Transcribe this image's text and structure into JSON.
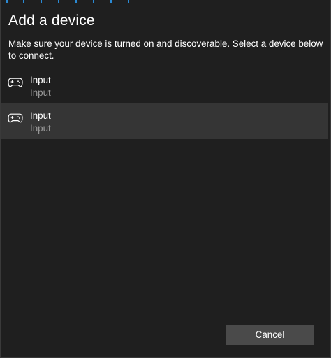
{
  "dialog": {
    "title": "Add a device",
    "instructions": "Make sure your device is turned on and discoverable. Select a device below to connect."
  },
  "devices": [
    {
      "name": "Input",
      "type": "Input",
      "icon": "gamepad-icon",
      "selected": false
    },
    {
      "name": "Input",
      "type": "Input",
      "icon": "gamepad-icon",
      "selected": true
    }
  ],
  "footer": {
    "cancel_label": "Cancel"
  },
  "colors": {
    "background": "#1f1f1f",
    "selected_row": "#353535",
    "button": "#4a4a4a",
    "accent": "#2a8ad4",
    "secondary_text": "#9a9a9a"
  }
}
